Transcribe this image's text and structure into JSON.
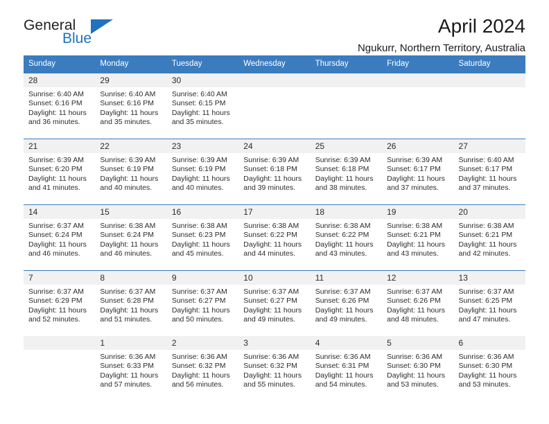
{
  "logo": {
    "word1": "General",
    "word2": "Blue",
    "icon": "triangle-mark"
  },
  "header": {
    "title": "April 2024",
    "subtitle": "Ngukurr, Northern Territory, Australia"
  },
  "calendar": {
    "weekday_headers": [
      "Sunday",
      "Monday",
      "Tuesday",
      "Wednesday",
      "Thursday",
      "Friday",
      "Saturday"
    ],
    "labels": {
      "sunrise": "Sunrise:",
      "sunset": "Sunset:",
      "daylight": "Daylight:"
    },
    "colors": {
      "header_blue": "#3b7cbf",
      "daynum_band": "#f1f1f1",
      "logo_blue": "#1f72bd",
      "text": "#2b2b2b"
    },
    "weeks": [
      [
        {
          "day": "",
          "lines": []
        },
        {
          "day": "1",
          "lines": [
            "Sunrise: 6:36 AM",
            "Sunset: 6:33 PM",
            "Daylight: 11 hours",
            "and 57 minutes."
          ]
        },
        {
          "day": "2",
          "lines": [
            "Sunrise: 6:36 AM",
            "Sunset: 6:32 PM",
            "Daylight: 11 hours",
            "and 56 minutes."
          ]
        },
        {
          "day": "3",
          "lines": [
            "Sunrise: 6:36 AM",
            "Sunset: 6:32 PM",
            "Daylight: 11 hours",
            "and 55 minutes."
          ]
        },
        {
          "day": "4",
          "lines": [
            "Sunrise: 6:36 AM",
            "Sunset: 6:31 PM",
            "Daylight: 11 hours",
            "and 54 minutes."
          ]
        },
        {
          "day": "5",
          "lines": [
            "Sunrise: 6:36 AM",
            "Sunset: 6:30 PM",
            "Daylight: 11 hours",
            "and 53 minutes."
          ]
        },
        {
          "day": "6",
          "lines": [
            "Sunrise: 6:36 AM",
            "Sunset: 6:30 PM",
            "Daylight: 11 hours",
            "and 53 minutes."
          ]
        }
      ],
      [
        {
          "day": "7",
          "lines": [
            "Sunrise: 6:37 AM",
            "Sunset: 6:29 PM",
            "Daylight: 11 hours",
            "and 52 minutes."
          ]
        },
        {
          "day": "8",
          "lines": [
            "Sunrise: 6:37 AM",
            "Sunset: 6:28 PM",
            "Daylight: 11 hours",
            "and 51 minutes."
          ]
        },
        {
          "day": "9",
          "lines": [
            "Sunrise: 6:37 AM",
            "Sunset: 6:27 PM",
            "Daylight: 11 hours",
            "and 50 minutes."
          ]
        },
        {
          "day": "10",
          "lines": [
            "Sunrise: 6:37 AM",
            "Sunset: 6:27 PM",
            "Daylight: 11 hours",
            "and 49 minutes."
          ]
        },
        {
          "day": "11",
          "lines": [
            "Sunrise: 6:37 AM",
            "Sunset: 6:26 PM",
            "Daylight: 11 hours",
            "and 49 minutes."
          ]
        },
        {
          "day": "12",
          "lines": [
            "Sunrise: 6:37 AM",
            "Sunset: 6:26 PM",
            "Daylight: 11 hours",
            "and 48 minutes."
          ]
        },
        {
          "day": "13",
          "lines": [
            "Sunrise: 6:37 AM",
            "Sunset: 6:25 PM",
            "Daylight: 11 hours",
            "and 47 minutes."
          ]
        }
      ],
      [
        {
          "day": "14",
          "lines": [
            "Sunrise: 6:37 AM",
            "Sunset: 6:24 PM",
            "Daylight: 11 hours",
            "and 46 minutes."
          ]
        },
        {
          "day": "15",
          "lines": [
            "Sunrise: 6:38 AM",
            "Sunset: 6:24 PM",
            "Daylight: 11 hours",
            "and 46 minutes."
          ]
        },
        {
          "day": "16",
          "lines": [
            "Sunrise: 6:38 AM",
            "Sunset: 6:23 PM",
            "Daylight: 11 hours",
            "and 45 minutes."
          ]
        },
        {
          "day": "17",
          "lines": [
            "Sunrise: 6:38 AM",
            "Sunset: 6:22 PM",
            "Daylight: 11 hours",
            "and 44 minutes."
          ]
        },
        {
          "day": "18",
          "lines": [
            "Sunrise: 6:38 AM",
            "Sunset: 6:22 PM",
            "Daylight: 11 hours",
            "and 43 minutes."
          ]
        },
        {
          "day": "19",
          "lines": [
            "Sunrise: 6:38 AM",
            "Sunset: 6:21 PM",
            "Daylight: 11 hours",
            "and 43 minutes."
          ]
        },
        {
          "day": "20",
          "lines": [
            "Sunrise: 6:38 AM",
            "Sunset: 6:21 PM",
            "Daylight: 11 hours",
            "and 42 minutes."
          ]
        }
      ],
      [
        {
          "day": "21",
          "lines": [
            "Sunrise: 6:39 AM",
            "Sunset: 6:20 PM",
            "Daylight: 11 hours",
            "and 41 minutes."
          ]
        },
        {
          "day": "22",
          "lines": [
            "Sunrise: 6:39 AM",
            "Sunset: 6:19 PM",
            "Daylight: 11 hours",
            "and 40 minutes."
          ]
        },
        {
          "day": "23",
          "lines": [
            "Sunrise: 6:39 AM",
            "Sunset: 6:19 PM",
            "Daylight: 11 hours",
            "and 40 minutes."
          ]
        },
        {
          "day": "24",
          "lines": [
            "Sunrise: 6:39 AM",
            "Sunset: 6:18 PM",
            "Daylight: 11 hours",
            "and 39 minutes."
          ]
        },
        {
          "day": "25",
          "lines": [
            "Sunrise: 6:39 AM",
            "Sunset: 6:18 PM",
            "Daylight: 11 hours",
            "and 38 minutes."
          ]
        },
        {
          "day": "26",
          "lines": [
            "Sunrise: 6:39 AM",
            "Sunset: 6:17 PM",
            "Daylight: 11 hours",
            "and 37 minutes."
          ]
        },
        {
          "day": "27",
          "lines": [
            "Sunrise: 6:40 AM",
            "Sunset: 6:17 PM",
            "Daylight: 11 hours",
            "and 37 minutes."
          ]
        }
      ],
      [
        {
          "day": "28",
          "lines": [
            "Sunrise: 6:40 AM",
            "Sunset: 6:16 PM",
            "Daylight: 11 hours",
            "and 36 minutes."
          ]
        },
        {
          "day": "29",
          "lines": [
            "Sunrise: 6:40 AM",
            "Sunset: 6:16 PM",
            "Daylight: 11 hours",
            "and 35 minutes."
          ]
        },
        {
          "day": "30",
          "lines": [
            "Sunrise: 6:40 AM",
            "Sunset: 6:15 PM",
            "Daylight: 11 hours",
            "and 35 minutes."
          ]
        },
        {
          "day": "",
          "lines": []
        },
        {
          "day": "",
          "lines": []
        },
        {
          "day": "",
          "lines": []
        },
        {
          "day": "",
          "lines": []
        }
      ]
    ]
  }
}
